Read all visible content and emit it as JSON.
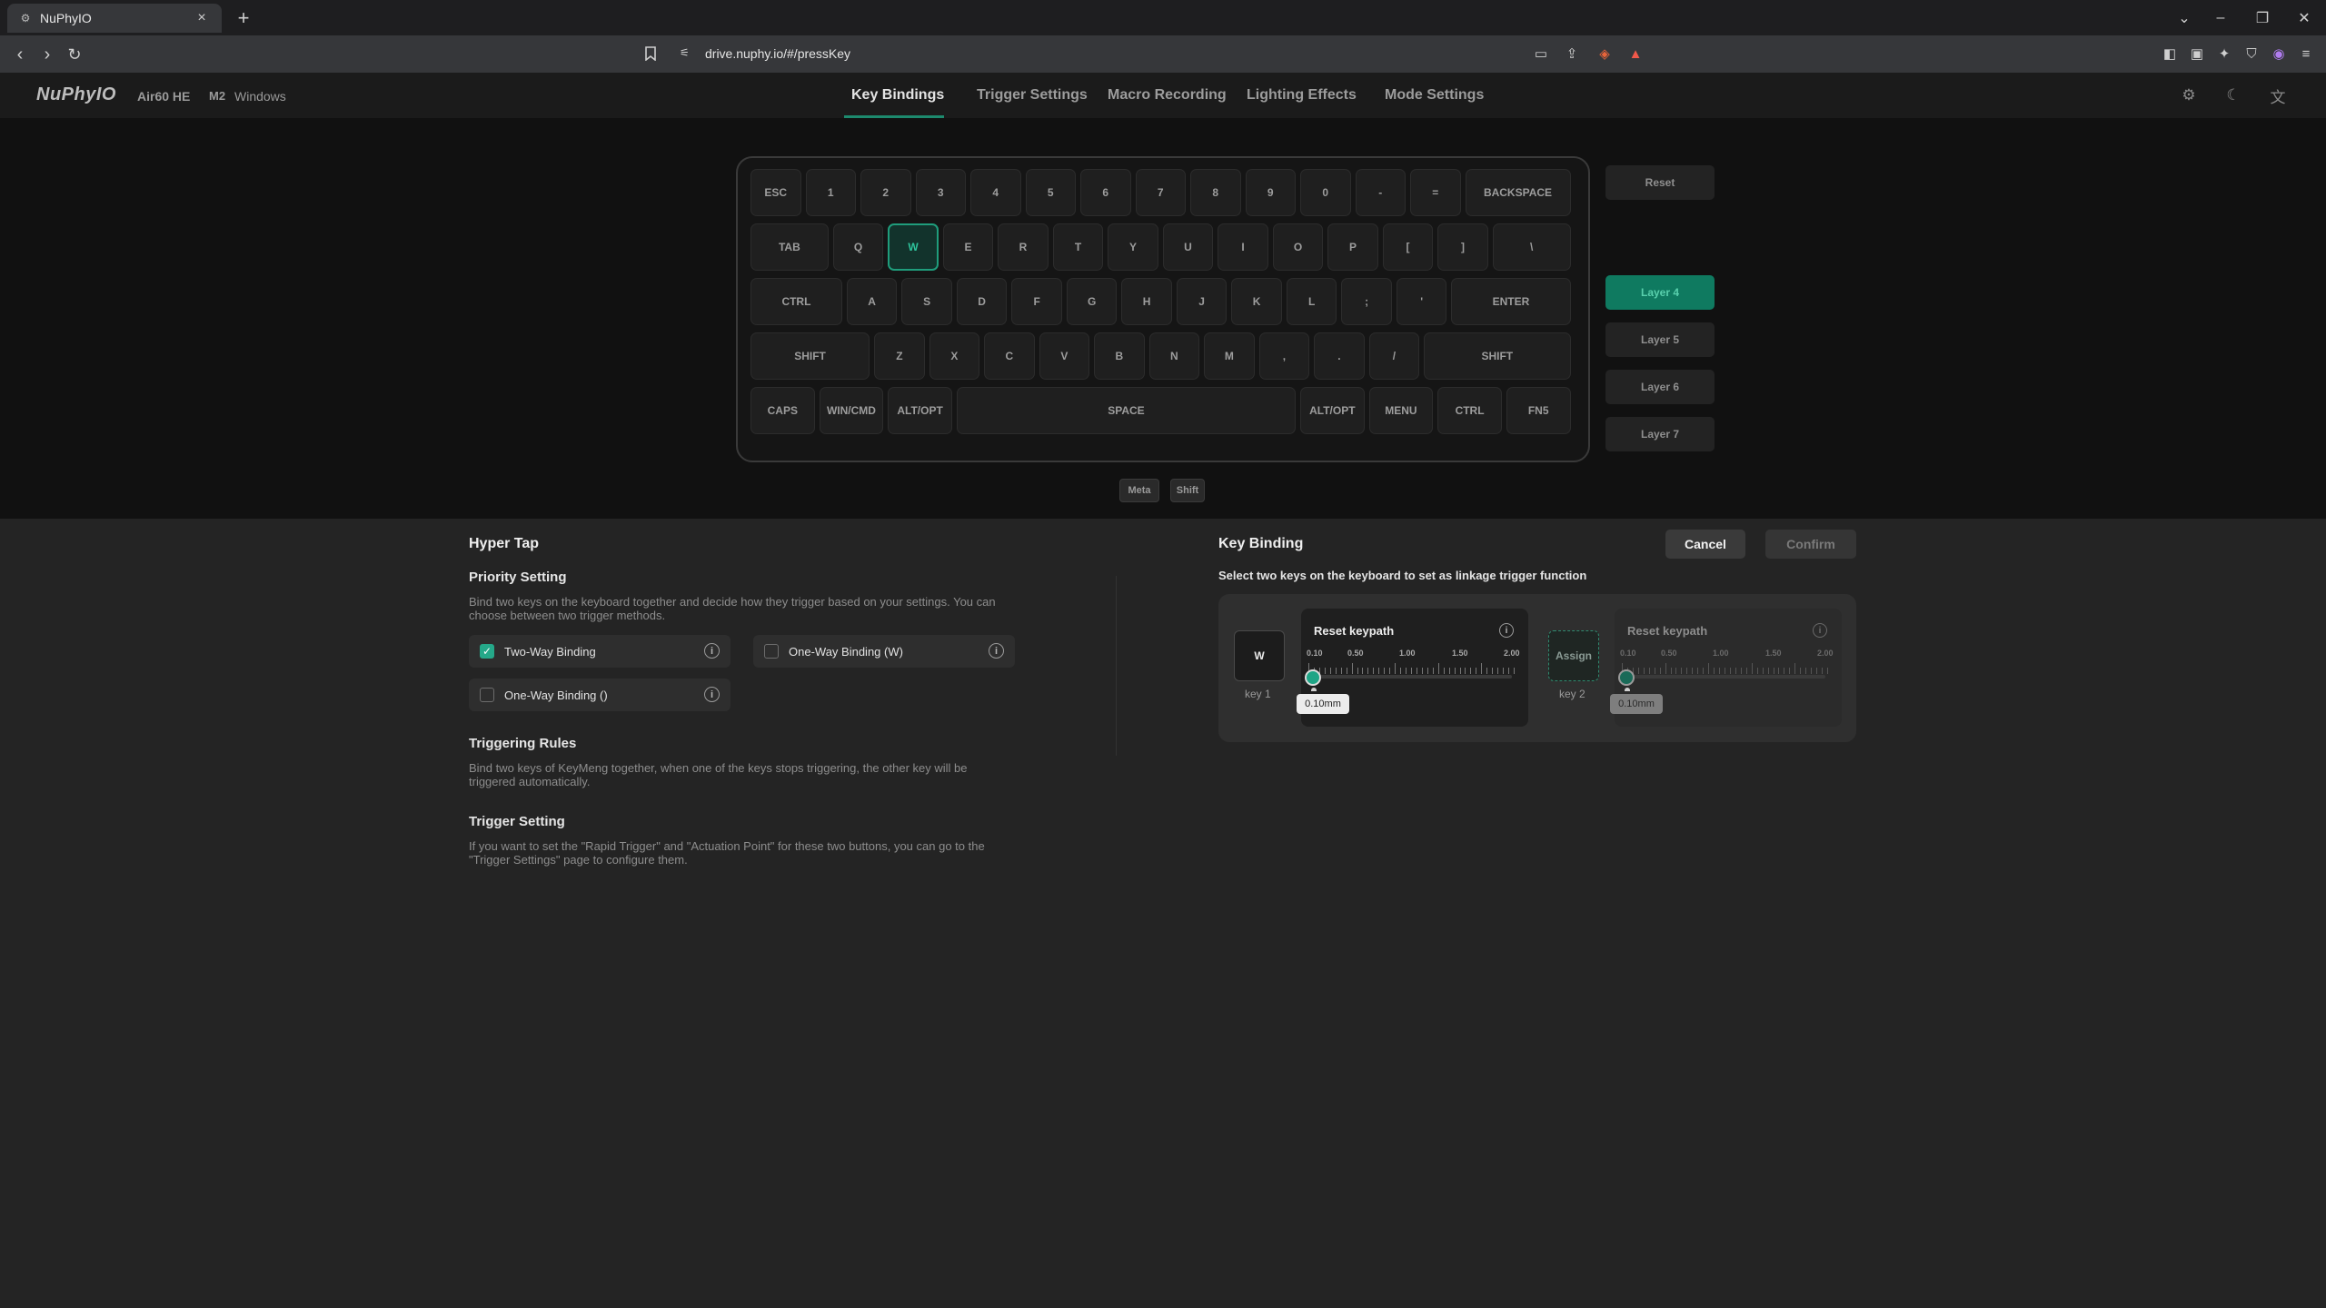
{
  "browser": {
    "tab_title": "NuPhyIO",
    "url": "drive.nuphy.io/#/pressKey",
    "favicon": "settings-icon",
    "win_min": "–",
    "win_restore": "❐",
    "win_close": "✕"
  },
  "app": {
    "logo": "NuPhyIO",
    "device_name": "Air60 HE",
    "device_mode": "M2",
    "device_os": "Windows",
    "nav": [
      {
        "label": "Key Bindings"
      },
      {
        "label": "Trigger Settings"
      },
      {
        "label": "Macro Recording"
      },
      {
        "label": "Lighting Effects"
      },
      {
        "label": "Mode Settings"
      }
    ],
    "active_nav": "Key Bindings",
    "accent_color": "#1d8a6e"
  },
  "keyboard": {
    "rows": [
      [
        "ESC",
        "1",
        "2",
        "3",
        "4",
        "5",
        "6",
        "7",
        "8",
        "9",
        "0",
        "-",
        "=",
        "BACKSPACE"
      ],
      [
        "TAB",
        "Q",
        "W",
        "E",
        "R",
        "T",
        "Y",
        "U",
        "I",
        "O",
        "P",
        "[",
        "]",
        "\\"
      ],
      [
        "CTRL",
        "A",
        "S",
        "D",
        "F",
        "G",
        "H",
        "J",
        "K",
        "L",
        ";",
        "'",
        "ENTER"
      ],
      [
        "SHIFT",
        "Z",
        "X",
        "C",
        "V",
        "B",
        "N",
        "M",
        ",",
        ".",
        "/",
        "SHIFT"
      ],
      [
        "CAPS",
        "WIN/CMD",
        "ALT/OPT",
        "SPACE",
        "ALT/OPT",
        "MENU",
        "CTRL",
        "FN5"
      ]
    ],
    "selected_key": "W",
    "reset_label": "Reset",
    "layers": [
      "Layer 4",
      "Layer 5",
      "Layer 6",
      "Layer 7"
    ],
    "active_layer": "Layer 4",
    "modifiers": [
      "Meta",
      "Shift"
    ]
  },
  "left_panel": {
    "title": "Hyper Tap",
    "priority_title": "Priority Setting",
    "priority_desc": "Bind two keys on the keyboard together and decide how they trigger based on your settings. You can choose between two trigger methods.",
    "options": [
      {
        "label": "Two-Way Binding",
        "checked": true
      },
      {
        "label": "One-Way Binding (W)",
        "checked": false
      },
      {
        "label": "One-Way Binding ()",
        "checked": false
      }
    ],
    "rules_title": "Triggering Rules",
    "rules_desc": "Bind two keys of KeyMeng together, when one of the keys stops triggering, the other key will be triggered automatically.",
    "trigger_title": "Trigger Setting",
    "trigger_desc": "If you want to set the \"Rapid Trigger\" and \"Actuation Point\" for these two buttons, you can go to the \"Trigger Settings\" page to configure them."
  },
  "right_panel": {
    "title": "Key Binding",
    "cancel": "Cancel",
    "confirm": "Confirm",
    "subtitle": "Select two keys on the keyboard to set as linkage trigger function",
    "key1": {
      "value": "W",
      "label": "key 1",
      "panel_title": "Reset keypath",
      "ticks": [
        "0.10",
        "0.50",
        "1.00",
        "1.50",
        "2.00"
      ],
      "tooltip": "0.10mm",
      "value_mm": 0.1
    },
    "key2": {
      "value": "Assign",
      "label": "key 2",
      "panel_title": "Reset keypath",
      "ticks": [
        "0.10",
        "0.50",
        "1.00",
        "1.50",
        "2.00"
      ],
      "tooltip": "0.10mm",
      "value_mm": 0.1
    }
  }
}
